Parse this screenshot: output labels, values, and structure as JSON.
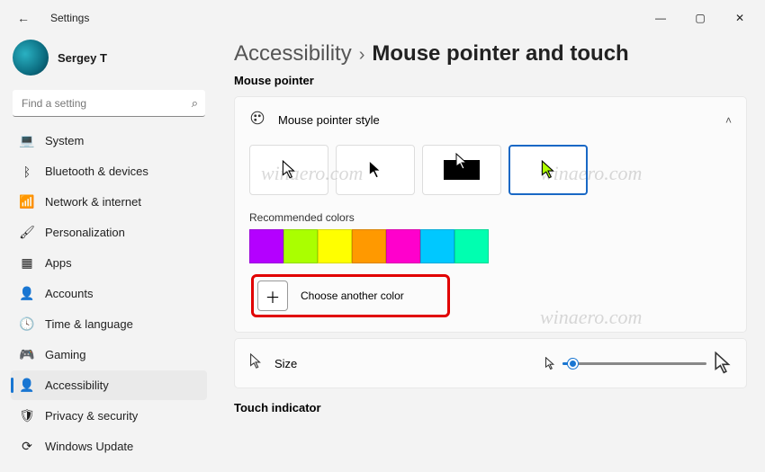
{
  "app_title": "Settings",
  "user": {
    "name": "Sergey T"
  },
  "search": {
    "placeholder": "Find a setting"
  },
  "sidebar": {
    "items": [
      {
        "label": "System",
        "icon": "💻"
      },
      {
        "label": "Bluetooth & devices",
        "icon": "ᛒ"
      },
      {
        "label": "Network & internet",
        "icon": "📶"
      },
      {
        "label": "Personalization",
        "icon": "🖌"
      },
      {
        "label": "Apps",
        "icon": "▦"
      },
      {
        "label": "Accounts",
        "icon": "👤"
      },
      {
        "label": "Time & language",
        "icon": "🕓"
      },
      {
        "label": "Gaming",
        "icon": "🎮"
      },
      {
        "label": "Accessibility",
        "icon": "👤",
        "selected": true
      },
      {
        "label": "Privacy & security",
        "icon": "🛡"
      },
      {
        "label": "Windows Update",
        "icon": "⟳"
      }
    ]
  },
  "breadcrumb": {
    "parent": "Accessibility",
    "sep": "›",
    "current": "Mouse pointer and touch"
  },
  "sections": {
    "mouse_pointer_label": "Mouse pointer",
    "style_header": "Mouse pointer style",
    "recommended_colors_label": "Recommended colors",
    "choose_another": "Choose another color",
    "size_label": "Size",
    "touch_indicator_label": "Touch indicator"
  },
  "colors": [
    "#b400ff",
    "#aaff00",
    "#ffff00",
    "#ff9900",
    "#ff00cc",
    "#00c8ff",
    "#00ffb0"
  ],
  "selected_style_index": 3,
  "watermark": "winaero.com"
}
